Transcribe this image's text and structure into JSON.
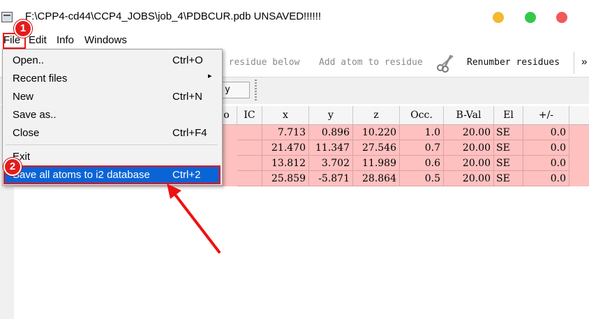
{
  "window": {
    "title": "F:\\CPP4-cd44\\CCP4_JOBS\\job_4\\PDBCUR.pdb UNSAVED!!!!!!",
    "controls": {
      "minimize_color": "#f5b82e",
      "maximize_color": "#34c84a",
      "close_color": "#f05a5a"
    }
  },
  "menubar": {
    "items": [
      "File",
      "Edit",
      "Info",
      "Windows"
    ]
  },
  "toolbar": {
    "items": [
      "t residue below",
      "Add atom to residue",
      "Renumber residues"
    ],
    "scissors_icon": "scissors-icon",
    "overflow": "»"
  },
  "toolbar2": {
    "apply_label": "y"
  },
  "table": {
    "columns": [
      "o",
      "IC",
      "x",
      "y",
      "z",
      "Occ.",
      "B-Val",
      "El",
      "+/-"
    ],
    "rows": [
      [
        "7.713",
        "0.896",
        "10.220",
        "1.0",
        "20.00",
        "SE",
        "0.0"
      ],
      [
        "21.470",
        "11.347",
        "27.546",
        "0.7",
        "20.00",
        "SE",
        "0.0"
      ],
      [
        "13.812",
        "3.702",
        "11.989",
        "0.6",
        "20.00",
        "SE",
        "0.0"
      ],
      [
        "25.859",
        "-5.871",
        "28.864",
        "0.5",
        "20.00",
        "SE",
        "0.0"
      ]
    ],
    "row_color": "#ffc0c0"
  },
  "file_menu": {
    "items": [
      {
        "label": "Open..",
        "shortcut": "Ctrl+O"
      },
      {
        "label": "Recent files",
        "shortcut": "▸"
      },
      {
        "label": "New",
        "shortcut": "Ctrl+N"
      },
      {
        "label": "Save as..",
        "shortcut": ""
      },
      {
        "label": "Close",
        "shortcut": "Ctrl+F4"
      },
      {
        "label": "Exit",
        "shortcut": ""
      },
      {
        "label": "Save all atoms to i2 database",
        "shortcut": "Ctrl+2"
      }
    ],
    "highlight_color": "#0a64d6"
  },
  "annotations": {
    "badge1": "1",
    "badge2": "2",
    "color": "#e11"
  }
}
